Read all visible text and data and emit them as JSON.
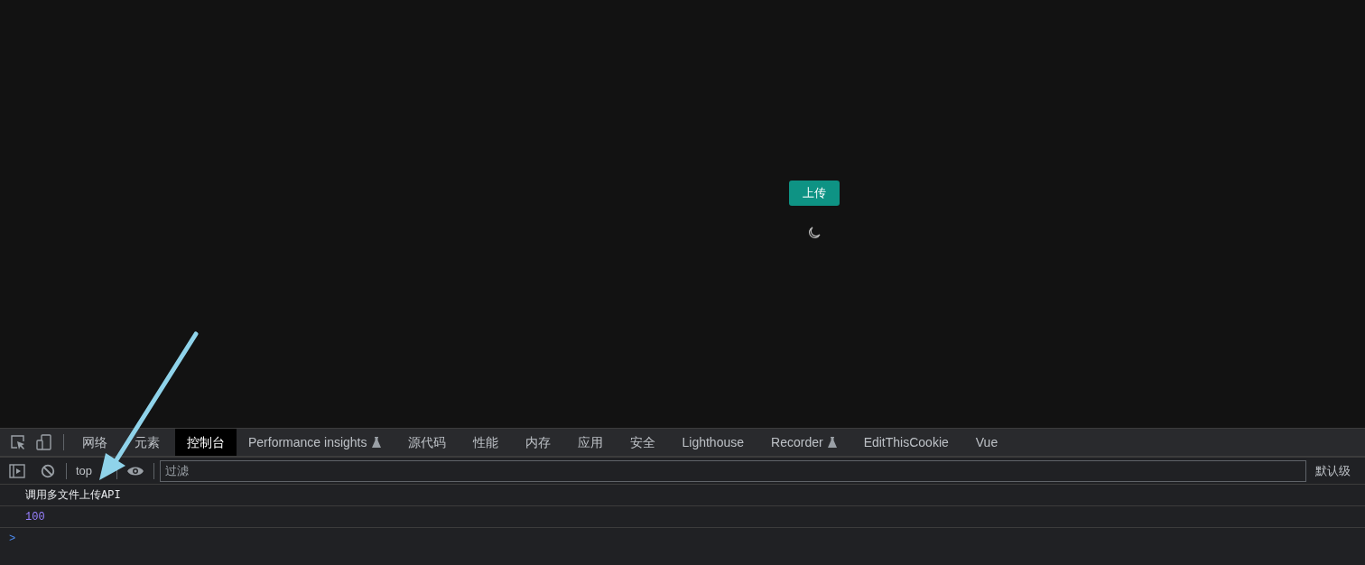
{
  "page": {
    "upload_button": "上传"
  },
  "devtools": {
    "tabs": [
      {
        "label": "网络",
        "selected": false,
        "experimental": false
      },
      {
        "label": "元素",
        "selected": false,
        "experimental": false
      },
      {
        "label": "控制台",
        "selected": true,
        "experimental": false
      },
      {
        "label": "Performance insights",
        "selected": false,
        "experimental": true
      },
      {
        "label": "源代码",
        "selected": false,
        "experimental": false
      },
      {
        "label": "性能",
        "selected": false,
        "experimental": false
      },
      {
        "label": "内存",
        "selected": false,
        "experimental": false
      },
      {
        "label": "应用",
        "selected": false,
        "experimental": false
      },
      {
        "label": "安全",
        "selected": false,
        "experimental": false
      },
      {
        "label": "Lighthouse",
        "selected": false,
        "experimental": false
      },
      {
        "label": "Recorder",
        "selected": false,
        "experimental": true
      },
      {
        "label": "EditThisCookie",
        "selected": false,
        "experimental": false
      },
      {
        "label": "Vue",
        "selected": false,
        "experimental": false
      }
    ],
    "toolbar": {
      "context": "top",
      "filter_placeholder": "过滤",
      "levels": "默认级"
    },
    "messages": [
      {
        "kind": "text",
        "text": "调用多文件上传API"
      },
      {
        "kind": "number",
        "text": "100"
      }
    ],
    "prompt": ">"
  }
}
